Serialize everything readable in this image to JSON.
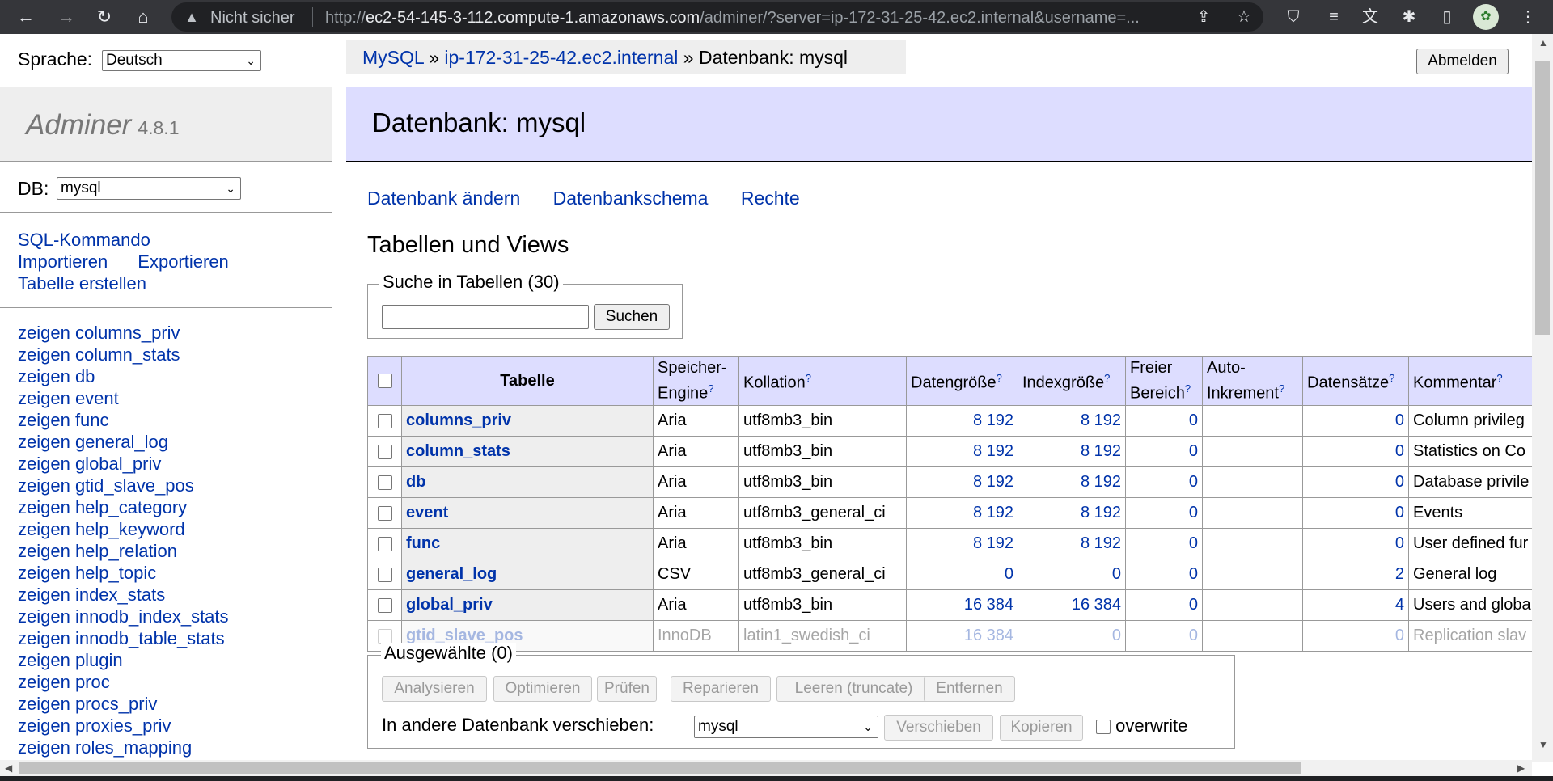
{
  "browser": {
    "security_label": "Nicht sicher",
    "url_scheme": "http://",
    "url_host": "ec2-54-145-3-112.compute-1.amazonaws.com",
    "url_rest": "/adminer/?server=ip-172-31-25-42.ec2.internal&username=..."
  },
  "language": {
    "label": "Sprache:",
    "selected": "Deutsch"
  },
  "menu": {
    "app_name": "Adminer",
    "version": "4.8.1",
    "db_label": "DB:",
    "db_selected": "mysql",
    "sql_command": "SQL-Kommando",
    "import": "Importieren",
    "export": "Exportieren",
    "create_table": "Tabelle erstellen",
    "table_links": [
      "zeigen columns_priv",
      "zeigen column_stats",
      "zeigen db",
      "zeigen event",
      "zeigen func",
      "zeigen general_log",
      "zeigen global_priv",
      "zeigen gtid_slave_pos",
      "zeigen help_category",
      "zeigen help_keyword",
      "zeigen help_relation",
      "zeigen help_topic",
      "zeigen index_stats",
      "zeigen innodb_index_stats",
      "zeigen innodb_table_stats",
      "zeigen plugin",
      "zeigen proc",
      "zeigen procs_priv",
      "zeigen proxies_priv",
      "zeigen roles_mapping"
    ]
  },
  "breadcrumb": {
    "driver": "MySQL",
    "sep1": "»",
    "server": "ip-172-31-25-42.ec2.internal",
    "sep2": "»",
    "current": "Datenbank: mysql"
  },
  "logout_label": "Abmelden",
  "page_title": "Datenbank: mysql",
  "actions": {
    "alter_db": "Datenbank ändern",
    "schema": "Datenbankschema",
    "privileges": "Rechte"
  },
  "section_title": "Tabellen und Views",
  "search": {
    "legend": "Suche in Tabellen (30)",
    "button": "Suchen",
    "value": ""
  },
  "table": {
    "headers": {
      "name": "Tabelle",
      "engine_1": "Speicher-",
      "engine_2": "Engine",
      "collation": "Kollation",
      "data_length": "Datengröße",
      "index_length": "Indexgröße",
      "free_1": "Freier",
      "free_2": "Bereich",
      "auto_1": "Auto-",
      "auto_2": "Inkrement",
      "rows": "Datensätze",
      "comment": "Kommentar",
      "help_mark": "?"
    },
    "rows": [
      {
        "name": "columns_priv",
        "engine": "Aria",
        "collation": "utf8mb3_bin",
        "data": "8 192",
        "index": "8 192",
        "free": "0",
        "auto": "",
        "rows": "0",
        "comment": "Column privileg"
      },
      {
        "name": "column_stats",
        "engine": "Aria",
        "collation": "utf8mb3_bin",
        "data": "8 192",
        "index": "8 192",
        "free": "0",
        "auto": "",
        "rows": "0",
        "comment": "Statistics on Co"
      },
      {
        "name": "db",
        "engine": "Aria",
        "collation": "utf8mb3_bin",
        "data": "8 192",
        "index": "8 192",
        "free": "0",
        "auto": "",
        "rows": "0",
        "comment": "Database privile"
      },
      {
        "name": "event",
        "engine": "Aria",
        "collation": "utf8mb3_general_ci",
        "data": "8 192",
        "index": "8 192",
        "free": "0",
        "auto": "",
        "rows": "0",
        "comment": "Events"
      },
      {
        "name": "func",
        "engine": "Aria",
        "collation": "utf8mb3_bin",
        "data": "8 192",
        "index": "8 192",
        "free": "0",
        "auto": "",
        "rows": "0",
        "comment": "User defined fur"
      },
      {
        "name": "general_log",
        "engine": "CSV",
        "collation": "utf8mb3_general_ci",
        "data": "0",
        "index": "0",
        "free": "0",
        "auto": "",
        "rows": "2",
        "comment": "General log"
      },
      {
        "name": "global_priv",
        "engine": "Aria",
        "collation": "utf8mb3_bin",
        "data": "16 384",
        "index": "16 384",
        "free": "0",
        "auto": "",
        "rows": "4",
        "comment": "Users and globa"
      },
      {
        "name": "gtid_slave_pos",
        "engine": "InnoDB",
        "collation": "latin1_swedish_ci",
        "data": "16 384",
        "index": "0",
        "free": "0",
        "auto": "",
        "rows": "0",
        "comment": "Replication slav"
      }
    ]
  },
  "selected": {
    "legend": "Ausgewählte (0)",
    "analyze": "Analysieren",
    "optimize": "Optimieren",
    "check": "Prüfen",
    "repair": "Reparieren",
    "truncate": "Leeren (truncate)",
    "drop": "Entfernen",
    "move_label": "In andere Datenbank verschieben:",
    "move_target": "mysql",
    "move_button": "Verschieben",
    "copy_button": "Kopieren",
    "overwrite_label": "overwrite"
  },
  "icons": {
    "back": "back-arrow-icon",
    "forward": "forward-arrow-icon",
    "reload": "reload-icon",
    "home": "home-icon",
    "warning": "warning-icon",
    "share": "share-icon",
    "star": "star-icon",
    "extensions": "puzzle-icon",
    "sidepanel": "side-panel-icon",
    "menu": "kebab-menu-icon"
  }
}
